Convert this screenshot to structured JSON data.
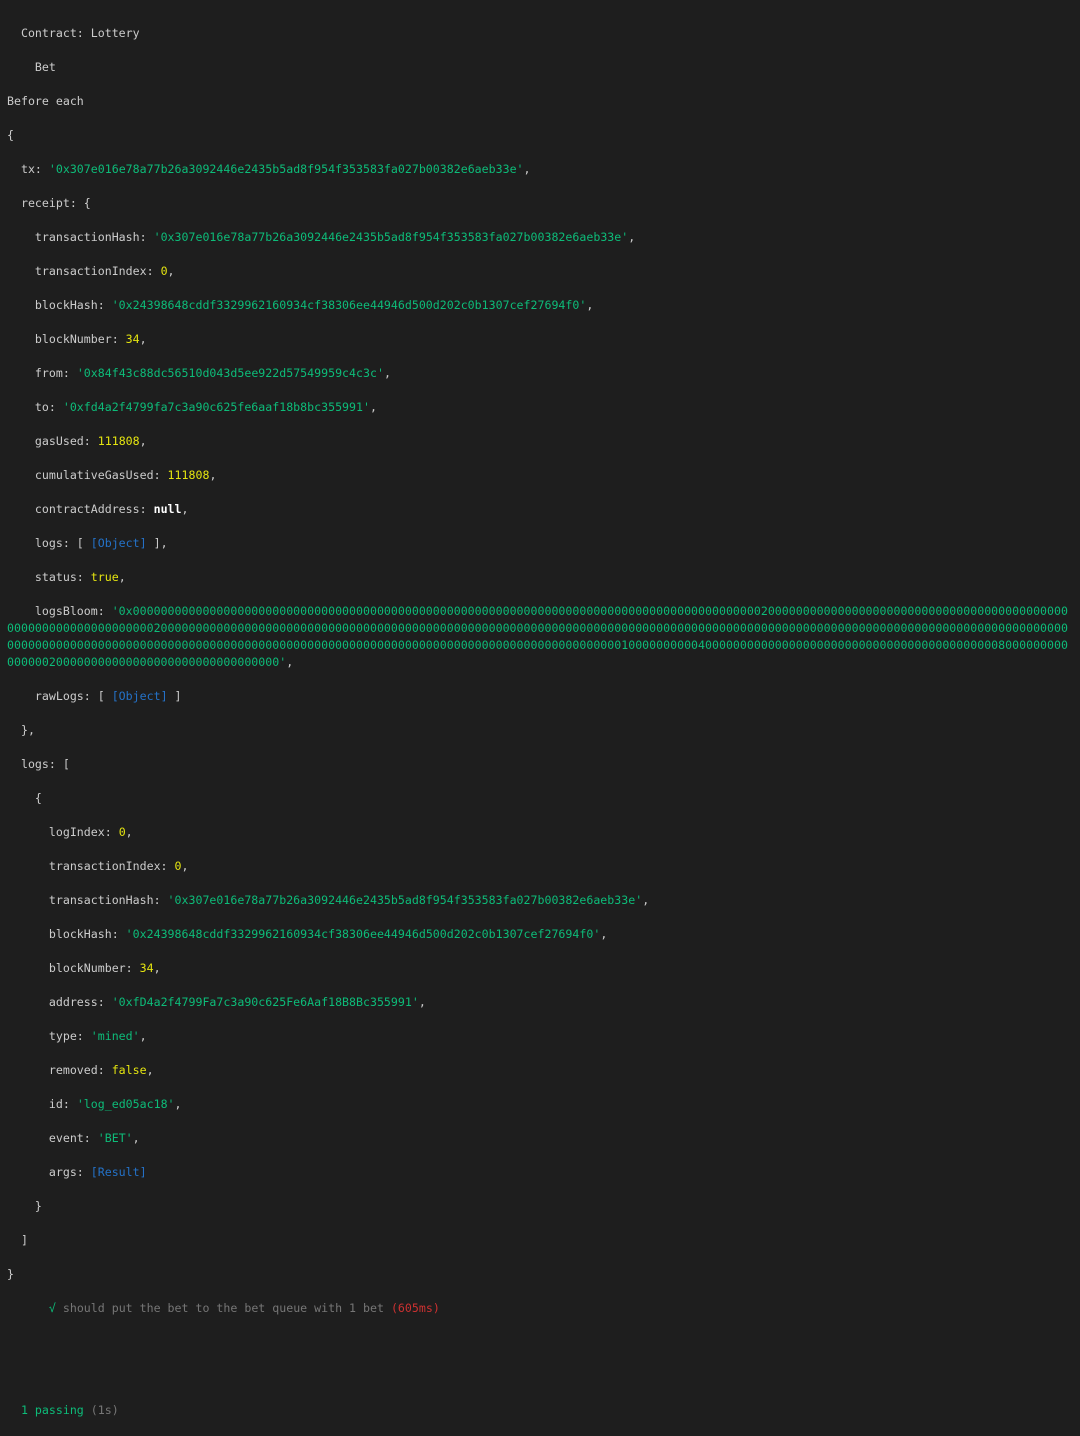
{
  "terminal": {
    "contract_header": "  Contract: Lottery",
    "describe": "    Bet",
    "before_each": "Before each",
    "tx_value": "'0x307e016e78a77b26a3092446e2435b5ad8f954f353583fa027b00382e6aeb33e'",
    "receipt": {
      "transactionHash": "'0x307e016e78a77b26a3092446e2435b5ad8f954f353583fa027b00382e6aeb33e'",
      "transactionIndex": "0",
      "blockHash": "'0x24398648cddf3329962160934cf38306ee44946d500d202c0b1307cef27694f0'",
      "blockNumber": "34",
      "from": "'0x84f43c88dc56510d043d5ee922d57549959c4c3c'",
      "to": "'0xfd4a2f4799fa7c3a90c625fe6aaf18b8bc355991'",
      "gasUsed": "111808",
      "cumulativeGasUsed": "111808",
      "contractAddress": "null",
      "logs_obj": "[Object]",
      "status": "true",
      "logsBloom": "'0x000000000000000000000000000000000000000000000000000000000000000000000000000000000000000000200000000000000000000000000000000000000000000000000000000000000002000000000000000000000000000000000000000000000000000000000000000000000000000000000000000000000000000000000000000000000000000000000000000000000000000000000000000000000000000000000000000000000000000000000000000000000000001000000000040000000000000000000000000000000000000000008000000000000000200000000000000000000000000000000'",
      "rawLogs_obj": "[Object]"
    },
    "log": {
      "logIndex": "0",
      "transactionIndex": "0",
      "transactionHash": "'0x307e016e78a77b26a3092446e2435b5ad8f954f353583fa027b00382e6aeb33e'",
      "blockHash": "'0x24398648cddf3329962160934cf38306ee44946d500d202c0b1307cef27694f0'",
      "blockNumber": "34",
      "address": "'0xfD4a2f4799Fa7c3a90c625Fe6Aaf18B8Bc355991'",
      "type": "'mined'",
      "removed": "false",
      "id": "'log_ed05ac18'",
      "event": "'BET'",
      "args": "[Result]"
    },
    "test": {
      "check": "√",
      "title": "should put the bet to the bet queue with 1 bet",
      "duration": "(605ms)"
    },
    "summary": {
      "passing": "1 passing",
      "time": "(1s)"
    }
  }
}
